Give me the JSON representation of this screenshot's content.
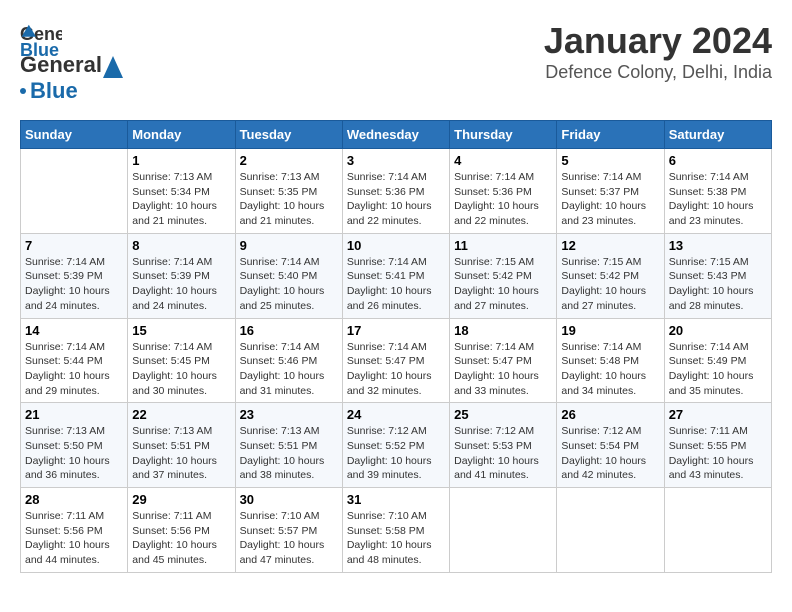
{
  "title": "January 2024",
  "subtitle": "Defence Colony, Delhi, India",
  "logo": {
    "line1": "General",
    "line2": "Blue"
  },
  "headers": [
    "Sunday",
    "Monday",
    "Tuesday",
    "Wednesday",
    "Thursday",
    "Friday",
    "Saturday"
  ],
  "weeks": [
    {
      "cells": [
        {
          "day": "",
          "info": ""
        },
        {
          "day": "1",
          "info": "Sunrise: 7:13 AM\nSunset: 5:34 PM\nDaylight: 10 hours\nand 21 minutes."
        },
        {
          "day": "2",
          "info": "Sunrise: 7:13 AM\nSunset: 5:35 PM\nDaylight: 10 hours\nand 21 minutes."
        },
        {
          "day": "3",
          "info": "Sunrise: 7:14 AM\nSunset: 5:36 PM\nDaylight: 10 hours\nand 22 minutes."
        },
        {
          "day": "4",
          "info": "Sunrise: 7:14 AM\nSunset: 5:36 PM\nDaylight: 10 hours\nand 22 minutes."
        },
        {
          "day": "5",
          "info": "Sunrise: 7:14 AM\nSunset: 5:37 PM\nDaylight: 10 hours\nand 23 minutes."
        },
        {
          "day": "6",
          "info": "Sunrise: 7:14 AM\nSunset: 5:38 PM\nDaylight: 10 hours\nand 23 minutes."
        }
      ]
    },
    {
      "cells": [
        {
          "day": "7",
          "info": "Sunrise: 7:14 AM\nSunset: 5:39 PM\nDaylight: 10 hours\nand 24 minutes."
        },
        {
          "day": "8",
          "info": "Sunrise: 7:14 AM\nSunset: 5:39 PM\nDaylight: 10 hours\nand 24 minutes."
        },
        {
          "day": "9",
          "info": "Sunrise: 7:14 AM\nSunset: 5:40 PM\nDaylight: 10 hours\nand 25 minutes."
        },
        {
          "day": "10",
          "info": "Sunrise: 7:14 AM\nSunset: 5:41 PM\nDaylight: 10 hours\nand 26 minutes."
        },
        {
          "day": "11",
          "info": "Sunrise: 7:15 AM\nSunset: 5:42 PM\nDaylight: 10 hours\nand 27 minutes."
        },
        {
          "day": "12",
          "info": "Sunrise: 7:15 AM\nSunset: 5:42 PM\nDaylight: 10 hours\nand 27 minutes."
        },
        {
          "day": "13",
          "info": "Sunrise: 7:15 AM\nSunset: 5:43 PM\nDaylight: 10 hours\nand 28 minutes."
        }
      ]
    },
    {
      "cells": [
        {
          "day": "14",
          "info": "Sunrise: 7:14 AM\nSunset: 5:44 PM\nDaylight: 10 hours\nand 29 minutes."
        },
        {
          "day": "15",
          "info": "Sunrise: 7:14 AM\nSunset: 5:45 PM\nDaylight: 10 hours\nand 30 minutes."
        },
        {
          "day": "16",
          "info": "Sunrise: 7:14 AM\nSunset: 5:46 PM\nDaylight: 10 hours\nand 31 minutes."
        },
        {
          "day": "17",
          "info": "Sunrise: 7:14 AM\nSunset: 5:47 PM\nDaylight: 10 hours\nand 32 minutes."
        },
        {
          "day": "18",
          "info": "Sunrise: 7:14 AM\nSunset: 5:47 PM\nDaylight: 10 hours\nand 33 minutes."
        },
        {
          "day": "19",
          "info": "Sunrise: 7:14 AM\nSunset: 5:48 PM\nDaylight: 10 hours\nand 34 minutes."
        },
        {
          "day": "20",
          "info": "Sunrise: 7:14 AM\nSunset: 5:49 PM\nDaylight: 10 hours\nand 35 minutes."
        }
      ]
    },
    {
      "cells": [
        {
          "day": "21",
          "info": "Sunrise: 7:13 AM\nSunset: 5:50 PM\nDaylight: 10 hours\nand 36 minutes."
        },
        {
          "day": "22",
          "info": "Sunrise: 7:13 AM\nSunset: 5:51 PM\nDaylight: 10 hours\nand 37 minutes."
        },
        {
          "day": "23",
          "info": "Sunrise: 7:13 AM\nSunset: 5:51 PM\nDaylight: 10 hours\nand 38 minutes."
        },
        {
          "day": "24",
          "info": "Sunrise: 7:12 AM\nSunset: 5:52 PM\nDaylight: 10 hours\nand 39 minutes."
        },
        {
          "day": "25",
          "info": "Sunrise: 7:12 AM\nSunset: 5:53 PM\nDaylight: 10 hours\nand 41 minutes."
        },
        {
          "day": "26",
          "info": "Sunrise: 7:12 AM\nSunset: 5:54 PM\nDaylight: 10 hours\nand 42 minutes."
        },
        {
          "day": "27",
          "info": "Sunrise: 7:11 AM\nSunset: 5:55 PM\nDaylight: 10 hours\nand 43 minutes."
        }
      ]
    },
    {
      "cells": [
        {
          "day": "28",
          "info": "Sunrise: 7:11 AM\nSunset: 5:56 PM\nDaylight: 10 hours\nand 44 minutes."
        },
        {
          "day": "29",
          "info": "Sunrise: 7:11 AM\nSunset: 5:56 PM\nDaylight: 10 hours\nand 45 minutes."
        },
        {
          "day": "30",
          "info": "Sunrise: 7:10 AM\nSunset: 5:57 PM\nDaylight: 10 hours\nand 47 minutes."
        },
        {
          "day": "31",
          "info": "Sunrise: 7:10 AM\nSunset: 5:58 PM\nDaylight: 10 hours\nand 48 minutes."
        },
        {
          "day": "",
          "info": ""
        },
        {
          "day": "",
          "info": ""
        },
        {
          "day": "",
          "info": ""
        }
      ]
    }
  ]
}
